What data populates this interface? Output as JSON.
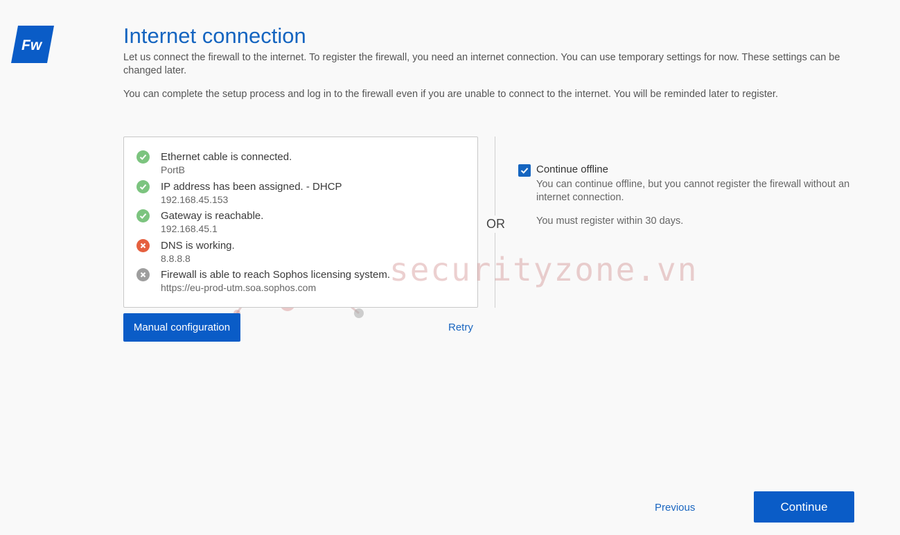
{
  "logo": {
    "text": "Fw",
    "color": "#0a5cc7"
  },
  "page": {
    "title": "Internet connection",
    "intro": "Let us connect the firewall to the internet. To register the firewall, you need an internet connection. You can use temporary settings for now. These settings can be changed later.",
    "intro2": "You can complete the setup process and log in to the firewall even if you are unable to connect to the internet. You will be reminded later to register."
  },
  "checks": [
    {
      "label": "Ethernet cable is connected.",
      "sub": "PortB",
      "status": "ok",
      "icon": "check-circle-icon"
    },
    {
      "label": "IP address has been assigned. - DHCP",
      "sub": "192.168.45.153",
      "status": "ok",
      "icon": "check-circle-icon"
    },
    {
      "label": "Gateway is reachable.",
      "sub": "192.168.45.1",
      "status": "ok",
      "icon": "check-circle-icon"
    },
    {
      "label": "DNS is working.",
      "sub": "8.8.8.8",
      "status": "error",
      "icon": "error-circle-icon"
    },
    {
      "label": "Firewall is able to reach Sophos licensing system.",
      "sub": "https://eu-prod-utm.soa.sophos.com",
      "status": "unknown",
      "icon": "pending-circle-icon"
    }
  ],
  "status_colors": {
    "ok": "#7cc47f",
    "error": "#e5603f",
    "unknown": "#9e9e9e"
  },
  "actions": {
    "manual_config": "Manual configuration",
    "retry": "Retry",
    "or": "OR"
  },
  "offline": {
    "checked": true,
    "label": "Continue offline",
    "description": "You can continue offline, but you cannot register the firewall without an internet connection.",
    "note": "You must register within 30 days."
  },
  "footer": {
    "previous": "Previous",
    "continue": "Continue"
  },
  "watermark": {
    "text": "securityzone.vn"
  }
}
